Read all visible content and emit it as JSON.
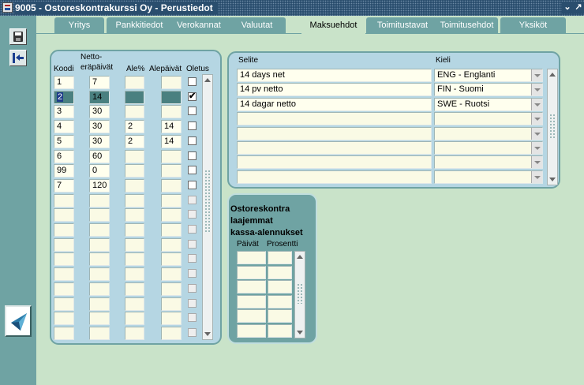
{
  "window": {
    "title": "9005 - Ostoreskontrakurssi Oy - Perustiedot",
    "minimize_glyph": "⌄",
    "maximize_glyph": "↗"
  },
  "toolbar": {
    "save_icon": "save-disk-icon",
    "exit_icon": "exit-arrow-icon",
    "logo_icon": "company-logo-icon"
  },
  "tabs": [
    {
      "label": "Yritys",
      "active": false
    },
    {
      "label": "Pankkitiedot",
      "active": false
    },
    {
      "label": "Verokannat",
      "active": false
    },
    {
      "label": "Valuutat",
      "active": false
    },
    {
      "label": "Maksuehdot",
      "active": true
    },
    {
      "label": "Toimitustavat",
      "active": false
    },
    {
      "label": "Toimitusehdot",
      "active": false
    },
    {
      "label": "Yksiköt",
      "active": false
    }
  ],
  "terms": {
    "headers": {
      "koodi": "Koodi",
      "netto_1": "Netto-",
      "netto_2": "eräpäivät",
      "ale": "Ale%",
      "alepaivat": "Alepäivät",
      "oletus": "Oletus"
    },
    "rows": [
      {
        "koodi": "1",
        "netto": "7",
        "ale": "",
        "alepaivat": "",
        "oletus": false
      },
      {
        "koodi": "2",
        "netto": "14",
        "ale": "",
        "alepaivat": "",
        "oletus": true,
        "selected": true
      },
      {
        "koodi": "3",
        "netto": "30",
        "ale": "",
        "alepaivat": "",
        "oletus": false
      },
      {
        "koodi": "4",
        "netto": "30",
        "ale": "2",
        "alepaivat": "14",
        "oletus": false
      },
      {
        "koodi": "5",
        "netto": "30",
        "ale": "2",
        "alepaivat": "14",
        "oletus": false
      },
      {
        "koodi": "6",
        "netto": "60",
        "ale": "",
        "alepaivat": "",
        "oletus": false
      },
      {
        "koodi": "99",
        "netto": "0",
        "ale": "",
        "alepaivat": "",
        "oletus": false
      },
      {
        "koodi": "7",
        "netto": "120",
        "ale": "",
        "alepaivat": "",
        "oletus": false
      },
      {
        "koodi": "",
        "netto": "",
        "ale": "",
        "alepaivat": "",
        "oletus": false
      },
      {
        "koodi": "",
        "netto": "",
        "ale": "",
        "alepaivat": "",
        "oletus": false
      },
      {
        "koodi": "",
        "netto": "",
        "ale": "",
        "alepaivat": "",
        "oletus": false
      },
      {
        "koodi": "",
        "netto": "",
        "ale": "",
        "alepaivat": "",
        "oletus": false
      },
      {
        "koodi": "",
        "netto": "",
        "ale": "",
        "alepaivat": "",
        "oletus": false
      },
      {
        "koodi": "",
        "netto": "",
        "ale": "",
        "alepaivat": "",
        "oletus": false
      },
      {
        "koodi": "",
        "netto": "",
        "ale": "",
        "alepaivat": "",
        "oletus": false
      },
      {
        "koodi": "",
        "netto": "",
        "ale": "",
        "alepaivat": "",
        "oletus": false
      },
      {
        "koodi": "",
        "netto": "",
        "ale": "",
        "alepaivat": "",
        "oletus": false
      },
      {
        "koodi": "",
        "netto": "",
        "ale": "",
        "alepaivat": "",
        "oletus": false
      }
    ]
  },
  "translations": {
    "headers": {
      "selite": "Selite",
      "kieli": "Kieli"
    },
    "rows": [
      {
        "selite": "14 days net",
        "kieli": "ENG - Englanti"
      },
      {
        "selite": "14 pv netto",
        "kieli": "FIN - Suomi"
      },
      {
        "selite": "14 dagar netto",
        "kieli": "SWE - Ruotsi"
      },
      {
        "selite": "",
        "kieli": ""
      },
      {
        "selite": "",
        "kieli": ""
      },
      {
        "selite": "",
        "kieli": ""
      },
      {
        "selite": "",
        "kieli": ""
      },
      {
        "selite": "",
        "kieli": ""
      }
    ]
  },
  "discounts": {
    "title_1": "Ostoreskontra",
    "title_2": "laajemmat",
    "title_3": "kassa-alennukset",
    "headers": {
      "paivat": "Päivät",
      "prosentti": "Prosentti"
    },
    "rows": [
      {
        "paivat": "",
        "prosentti": ""
      },
      {
        "paivat": "",
        "prosentti": ""
      },
      {
        "paivat": "",
        "prosentti": ""
      },
      {
        "paivat": "",
        "prosentti": ""
      },
      {
        "paivat": "",
        "prosentti": ""
      },
      {
        "paivat": "",
        "prosentti": ""
      }
    ]
  },
  "colors": {
    "title_bar": "#2a4e6e",
    "workspace": "#6fa3a3",
    "canvas": "#c9e3c9",
    "panel": "#b5d6e3",
    "field": "#ffffee"
  }
}
